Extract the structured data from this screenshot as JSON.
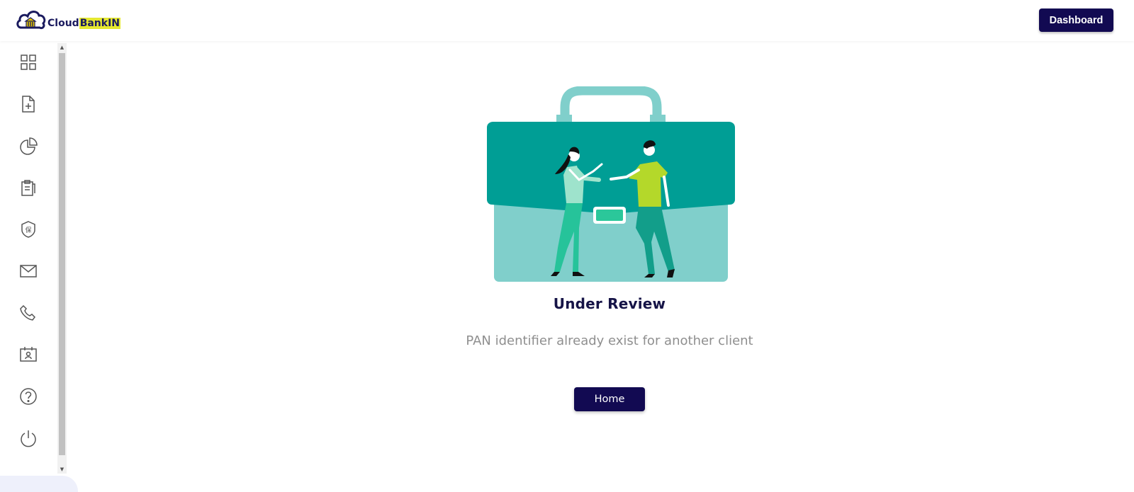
{
  "header": {
    "logo_text_1": "Cloud",
    "logo_text_2": "BankIN",
    "dashboard_button": "Dashboard"
  },
  "sidebar": {
    "icons": [
      "dashboard-grid-icon",
      "add-document-icon",
      "pie-chart-icon",
      "clipboard-icon",
      "shield-icon",
      "mail-icon",
      "phone-icon",
      "contact-card-icon",
      "help-icon",
      "power-icon"
    ]
  },
  "main": {
    "title": "Under Review",
    "message": "PAN identifier already exist for another client",
    "home_button": "Home"
  },
  "colors": {
    "primary": "#120a52",
    "teal_dark": "#009e95",
    "teal_light": "#80cfcb",
    "lime": "#b4d82a"
  }
}
